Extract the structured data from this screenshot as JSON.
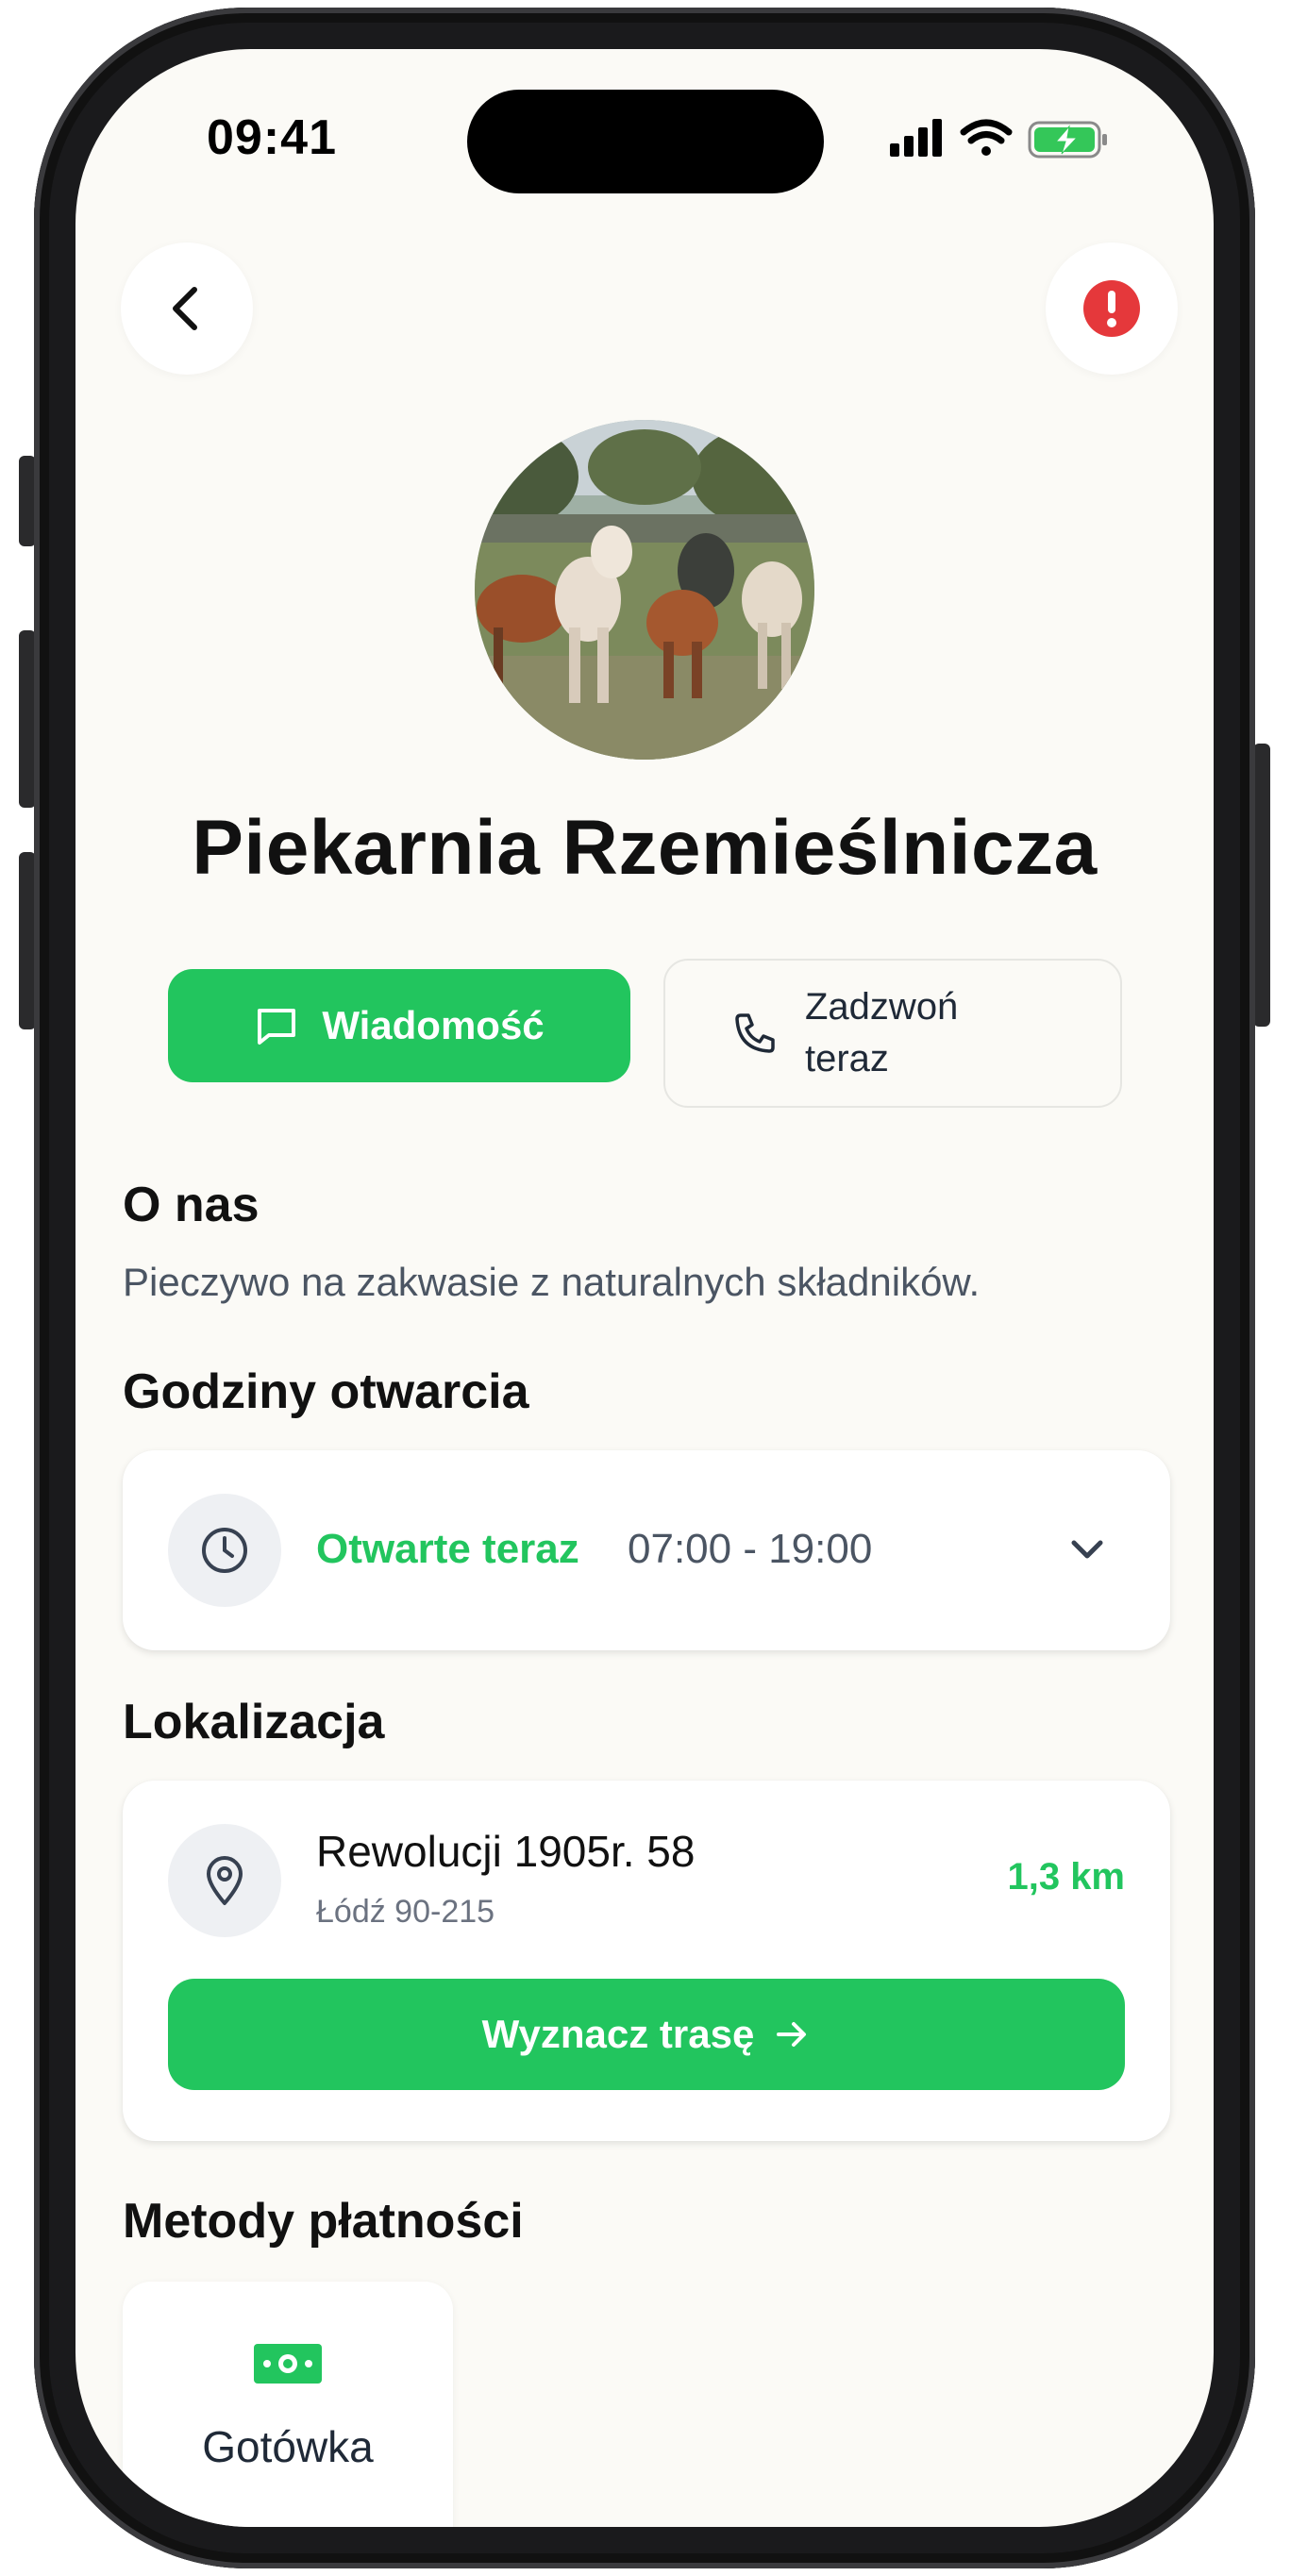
{
  "status_bar": {
    "time": "09:41"
  },
  "header": {
    "back_icon": "chevron-left-icon",
    "alert_icon": "exclamation-circle-icon",
    "alert_color": "#e5383b"
  },
  "profile": {
    "name": "Piekarnia Rzemieślnicza",
    "avatar": "cows-photo"
  },
  "actions": {
    "message_label": "Wiadomość",
    "call_label": "Zadzwoń teraz"
  },
  "about": {
    "heading": "O nas",
    "text": "Pieczywo na zakwasie z naturalnych składników."
  },
  "hours": {
    "heading": "Godziny otwarcia",
    "status": "Otwarte teraz",
    "range": "07:00 - 19:00"
  },
  "location": {
    "heading": "Lokalizacja",
    "street": "Rewolucji 1905r. 58",
    "city": "Łódź 90-215",
    "distance": "1,3 km",
    "route_label": "Wyznacz trasę"
  },
  "payments": {
    "heading": "Metody płatności",
    "methods": [
      {
        "label": "Gotówka",
        "icon": "cash-icon"
      }
    ]
  },
  "colors": {
    "accent": "#22c55e",
    "background": "#fbfaf6"
  }
}
